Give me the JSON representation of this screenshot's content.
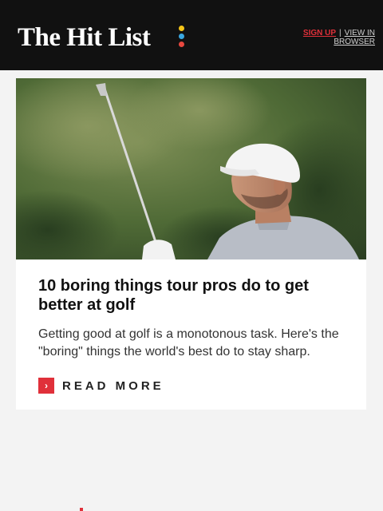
{
  "header": {
    "logo_text": "The Hit List",
    "links": {
      "signup": "SIGN UP",
      "separator": "|",
      "view_in_browser": "VIEW IN BROWSER"
    }
  },
  "article": {
    "image_subject": "golfer-follow-through-photo",
    "title": "10 boring things tour pros do to get better at golf",
    "description": "Getting good at golf is a monotonous task. Here's the \"boring\" things the world's best do to stay sharp.",
    "read_more": "READ MORE",
    "read_more_icon": "chevron-right-icon"
  },
  "colors": {
    "header_bg": "#111111",
    "accent_red": "#e0303a",
    "dot_yellow": "#f5c518",
    "dot_blue": "#3aa7e0",
    "dot_red": "#e8483f"
  }
}
